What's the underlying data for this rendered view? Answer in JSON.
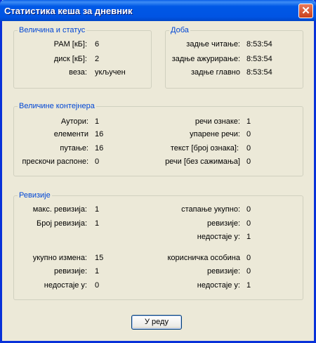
{
  "window": {
    "title": "Статистика кеша за дневник",
    "close_label": "✕"
  },
  "size_status": {
    "legend": "Величина и статус",
    "rows": [
      {
        "label": "РАМ [кБ]:",
        "value": "6"
      },
      {
        "label": "диск [кБ]:",
        "value": "2"
      },
      {
        "label": "веза:",
        "value": "укључен"
      }
    ]
  },
  "time": {
    "legend": "Доба",
    "rows": [
      {
        "label": "задње читање:",
        "value": "8:53:54"
      },
      {
        "label": "задње ажурирање:",
        "value": "8:53:54"
      },
      {
        "label": "задње главно",
        "value": "8:53:54"
      }
    ]
  },
  "containers": {
    "legend": "Величине контејнера",
    "left": [
      {
        "label": "Аутори:",
        "value": "1"
      },
      {
        "label": "елементи",
        "value": "16"
      },
      {
        "label": "путање:",
        "value": "16"
      },
      {
        "label": "прескочи распоне:",
        "value": "0"
      }
    ],
    "right": [
      {
        "label": "речи ознаке:",
        "value": "1"
      },
      {
        "label": "упарене речи:",
        "value": "0"
      },
      {
        "label": "текст [број ознака]:",
        "value": "0"
      },
      {
        "label": "речи [без сажимања]",
        "value": "0"
      }
    ]
  },
  "revisions": {
    "legend": "Ревизије",
    "left": [
      {
        "label": "макс. ревизија:",
        "value": "1"
      },
      {
        "label": "Број ревизија:",
        "value": "1"
      },
      {
        "label": "укупно измена:",
        "value": "15"
      },
      {
        "label": "ревизије:",
        "value": "1"
      },
      {
        "label": "недостаје у:",
        "value": "0"
      }
    ],
    "right": [
      {
        "label": "стапање укупно:",
        "value": "0"
      },
      {
        "label": "ревизије:",
        "value": "0"
      },
      {
        "label": "недостаје у:",
        "value": "1"
      },
      {
        "label": "корисничка особина",
        "value": "0"
      },
      {
        "label": "ревизије:",
        "value": "0"
      },
      {
        "label": "недостаје у:",
        "value": "1"
      }
    ]
  },
  "ok_button": "У реду"
}
